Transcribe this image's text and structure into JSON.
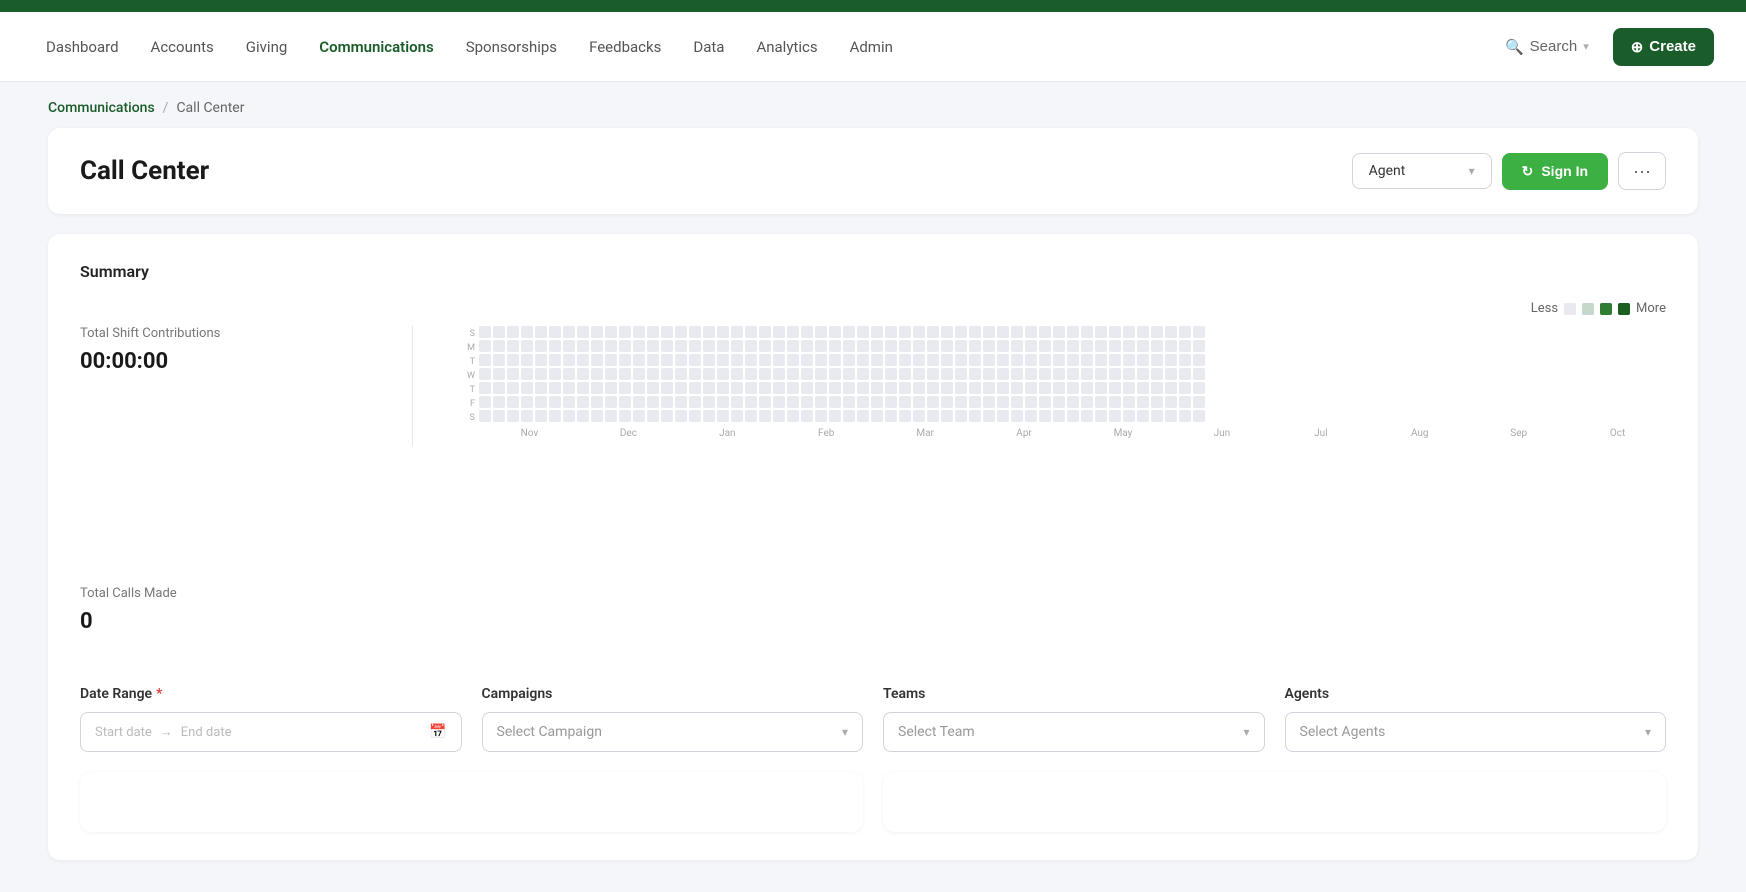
{
  "topbar": {},
  "nav": {
    "items": [
      {
        "label": "Dashboard",
        "active": false
      },
      {
        "label": "Accounts",
        "active": false
      },
      {
        "label": "Giving",
        "active": false
      },
      {
        "label": "Communications",
        "active": true
      },
      {
        "label": "Sponsorships",
        "active": false
      },
      {
        "label": "Feedbacks",
        "active": false
      },
      {
        "label": "Data",
        "active": false
      },
      {
        "label": "Analytics",
        "active": false
      },
      {
        "label": "Admin",
        "active": false
      }
    ],
    "search_label": "Search",
    "create_label": "Create"
  },
  "breadcrumb": {
    "link_label": "Communications",
    "separator": "/",
    "current_label": "Call Center"
  },
  "page_header": {
    "title": "Call Center",
    "agent_dropdown_label": "Agent",
    "signin_label": "Sign In",
    "more_label": "···"
  },
  "summary": {
    "title": "Summary",
    "legend": {
      "less_label": "Less",
      "more_label": "More"
    },
    "stats": {
      "total_shift_contributions_label": "Total Shift Contributions",
      "total_shift_contributions_value": "00:00:00",
      "total_calls_made_label": "Total Calls Made",
      "total_calls_made_value": "0"
    },
    "months": [
      "Nov",
      "Dec",
      "Jan",
      "Feb",
      "Mar",
      "Apr",
      "May",
      "Jun",
      "Jul",
      "Aug",
      "Sep",
      "Oct"
    ],
    "days": [
      "S",
      "M",
      "T",
      "W",
      "T",
      "F",
      "S"
    ]
  },
  "filters": {
    "date_range": {
      "label": "Date Range",
      "required": true,
      "start_placeholder": "Start date",
      "end_placeholder": "End date"
    },
    "campaigns": {
      "label": "Campaigns",
      "placeholder": "Select Campaign"
    },
    "teams": {
      "label": "Teams",
      "placeholder": "Select Team"
    },
    "agents": {
      "label": "Agents",
      "placeholder": "Select Agents"
    }
  },
  "colors": {
    "nav_active": "#1a5c2a",
    "brand_green": "#3cb043",
    "dark_green": "#1a5c2a"
  }
}
